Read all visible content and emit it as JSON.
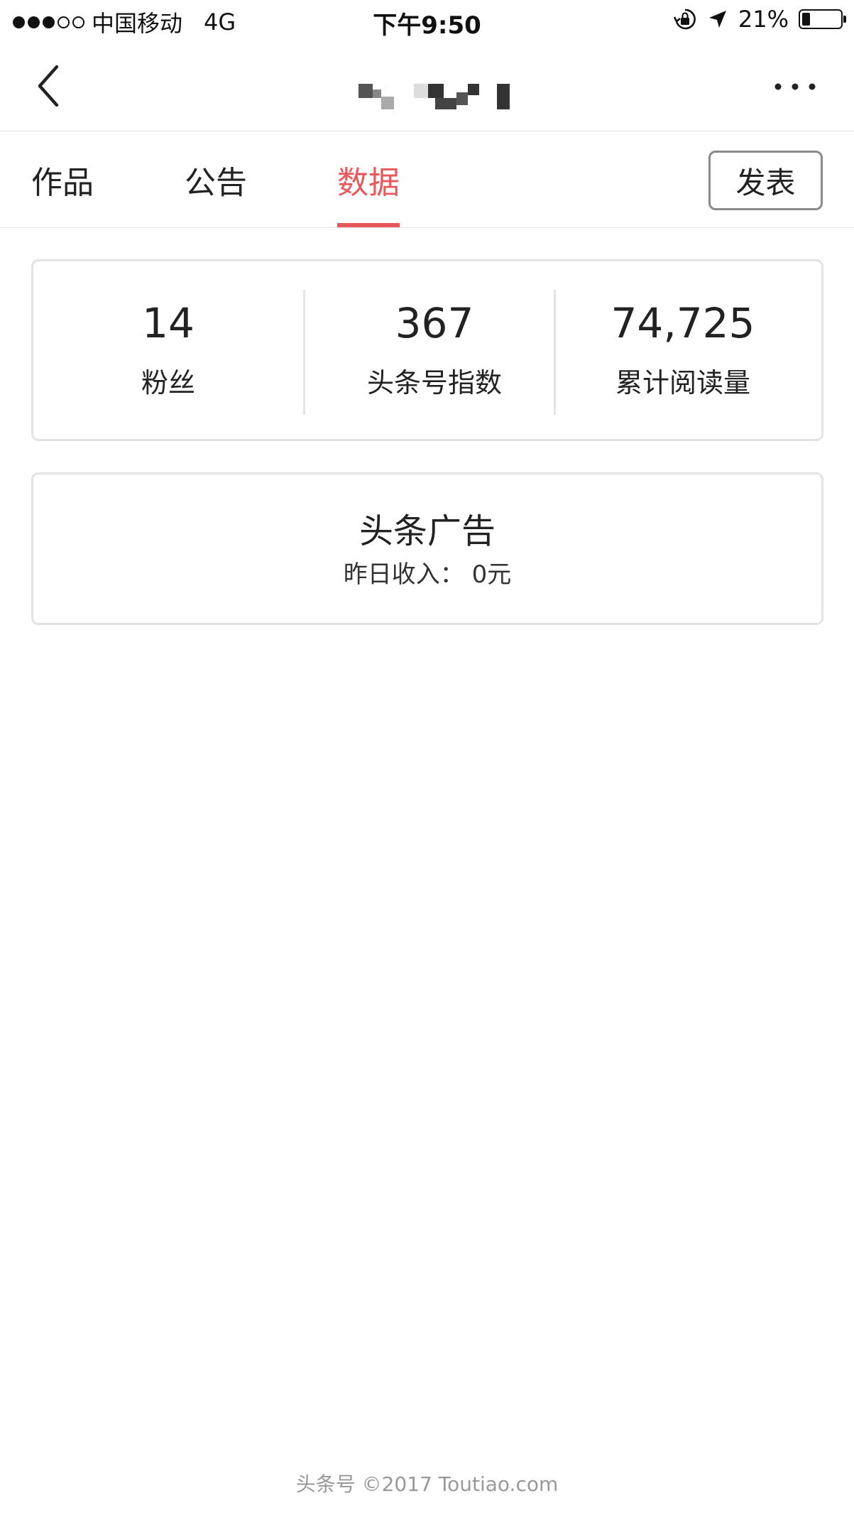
{
  "status_bar": {
    "carrier": "中国移动",
    "network": "4G",
    "time": "下午9:50",
    "battery": "21%",
    "battery_level": 0.21,
    "signal_bars": 3,
    "signal_total": 5,
    "icons": [
      "orientation-lock-icon",
      "location-arrow-icon",
      "battery-icon"
    ]
  },
  "nav": {
    "title_obscured": true,
    "icons": [
      "chevron-left-icon",
      "more-dots-icon"
    ]
  },
  "tabs": [
    {
      "label": "作品",
      "active": false
    },
    {
      "label": "公告",
      "active": false
    },
    {
      "label": "数据",
      "active": true
    }
  ],
  "publish_button": "发表",
  "stats": [
    {
      "value": "14",
      "label": "粉丝"
    },
    {
      "value": "367",
      "label": "头条号指数"
    },
    {
      "value": "74,725",
      "label": "累计阅读量"
    }
  ],
  "ad_card": {
    "title": "头条广告",
    "income_label": "昨日收入：",
    "income_value": "0元"
  },
  "footer": "头条号 ©2017 Toutiao.com",
  "colors": {
    "accent": "#e8575a",
    "border": "#e3e3e3",
    "text": "#222222",
    "muted": "#999999"
  }
}
